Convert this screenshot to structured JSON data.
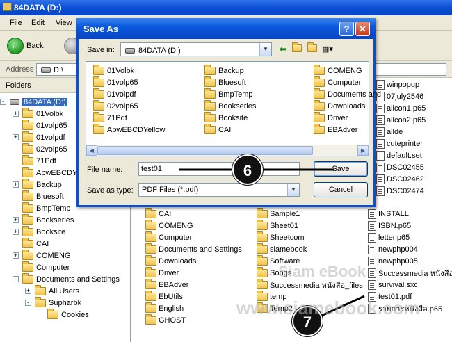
{
  "explorer": {
    "title": "84DATA (D:)",
    "menu": [
      "File",
      "Edit",
      "View"
    ],
    "back_label": "Back",
    "address_label": "Address",
    "address_value": "D:\\",
    "folders_header": "Folders"
  },
  "tree": [
    {
      "label": "84DATA (D:)",
      "expander": "-",
      "drive": true
    },
    {
      "label": "01Volbk",
      "expander": "+"
    },
    {
      "label": "01volp65",
      "expander": ""
    },
    {
      "label": "01volpdf",
      "expander": "+"
    },
    {
      "label": "02volp65",
      "expander": ""
    },
    {
      "label": "71Pdf",
      "expander": ""
    },
    {
      "label": "ApwEBCDYellow",
      "expander": ""
    },
    {
      "label": "Backup",
      "expander": "+"
    },
    {
      "label": "Bluesoft",
      "expander": ""
    },
    {
      "label": "BmpTemp",
      "expander": ""
    },
    {
      "label": "Bookseries",
      "expander": "+"
    },
    {
      "label": "Booksite",
      "expander": "+"
    },
    {
      "label": "CAI",
      "expander": ""
    },
    {
      "label": "COMENG",
      "expander": "+"
    },
    {
      "label": "Computer",
      "expander": ""
    },
    {
      "label": "Documents and Settings",
      "expander": "-"
    },
    {
      "label": "All Users",
      "expander": "+"
    },
    {
      "label": "Supharbk",
      "expander": "-"
    },
    {
      "label": "Cookies",
      "expander": ""
    }
  ],
  "content": {
    "col1": [
      "CAI",
      "COMENG",
      "Computer",
      "Documents and Settings",
      "Downloads",
      "Driver",
      "EBAdver",
      "EbUtils",
      "English",
      "GHOST"
    ],
    "col2": [
      "Sample1",
      "Sheet01",
      "Sheetcom",
      "siamebook",
      "Software",
      "Songs",
      "Successmedia หนังสือ_files",
      "temp",
      "Temp2"
    ],
    "col3_top": [
      "winpopup",
      "07july2546",
      "allcon1.p65",
      "allcon2.p65",
      "allde",
      "cuteprinter",
      "default.set",
      "DSC02455",
      "DSC02462",
      "DSC02474"
    ],
    "col3": [
      "INSTALL",
      "ISBN.p65",
      "letter.p65",
      "newphp004",
      "newphp005",
      "Successmedia หนังสือ",
      "survival.sxc",
      "test01.pdf",
      "รายการหนังสือ.p65"
    ]
  },
  "dialog": {
    "title": "Save As",
    "help": "?",
    "close": "✕",
    "save_in_label": "Save in:",
    "save_in_value": "84DATA (D:)",
    "list_col1": [
      "01Volbk",
      "01volp65",
      "01volpdf",
      "02volp65",
      "71Pdf",
      "ApwEBCDYellow"
    ],
    "list_col2": [
      "Backup",
      "Bluesoft",
      "BmpTemp",
      "Bookseries",
      "Booksite",
      "CAI"
    ],
    "list_col3": [
      "COMENG",
      "Computer",
      "Documents and",
      "Downloads",
      "Driver",
      "EBAdver"
    ],
    "file_name_label": "File name:",
    "file_name_value": "test01",
    "save_type_label": "Save as type:",
    "save_type_value": "PDF Files (*.pdf)",
    "save_button": "Save",
    "cancel_button": "Cancel"
  },
  "callouts": {
    "step6": "6",
    "step7": "7"
  },
  "watermark": {
    "line1": "Siam eBook",
    "line2": "www.siamebook.com"
  },
  "icons": {
    "back": "back-arrow-icon",
    "up": "up-folder-icon",
    "new_folder": "new-folder-icon",
    "views": "views-menu-icon"
  }
}
